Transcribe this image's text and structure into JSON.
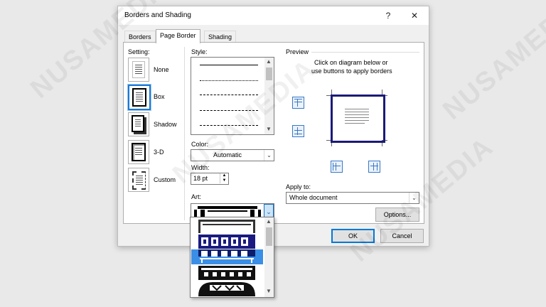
{
  "dialog": {
    "title": "Borders and Shading",
    "help_label": "?",
    "close_label": "✕"
  },
  "tabs": [
    {
      "label": "Borders",
      "active": false
    },
    {
      "label": "Page Border",
      "active": true
    },
    {
      "label": "Shading",
      "active": false
    }
  ],
  "setting": {
    "label": "Setting:",
    "options": [
      {
        "label": "None",
        "selected": false
      },
      {
        "label": "Box",
        "selected": true
      },
      {
        "label": "Shadow",
        "selected": false
      },
      {
        "label": "3-D",
        "selected": false
      },
      {
        "label": "Custom",
        "selected": false
      }
    ]
  },
  "style": {
    "label": "Style:",
    "scroll_up": "▲",
    "scroll_down": "▼"
  },
  "color": {
    "label": "Color:",
    "value": "Automatic"
  },
  "width": {
    "label": "Width:",
    "value": "18 pt"
  },
  "art": {
    "label": "Art:"
  },
  "preview": {
    "label": "Preview",
    "instructions_line1": "Click on diagram below or",
    "instructions_line2": "use buttons to apply borders"
  },
  "apply_to": {
    "label": "Apply to:",
    "value": "Whole document"
  },
  "buttons": {
    "options": "Options...",
    "ok": "OK",
    "cancel": "Cancel"
  },
  "icons": {
    "dropdown": "chevron-down-icon",
    "spin_up": "▲",
    "spin_down": "▼",
    "chevron": "⌄"
  },
  "watermark": {
    "text": "NUSAMEDIA"
  },
  "colors": {
    "accent": "#0078d7",
    "selection": "#3a8ee6",
    "preview_border": "#1a1a78"
  }
}
